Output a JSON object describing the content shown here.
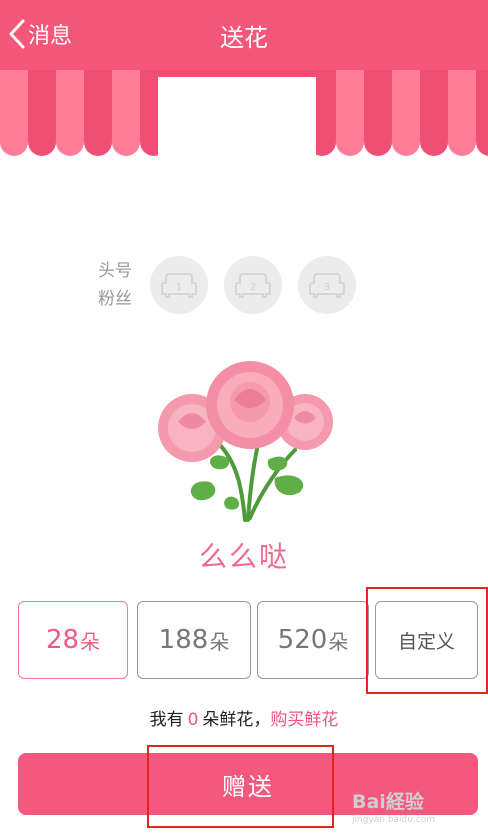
{
  "header": {
    "back_label": "消息",
    "title": "送花"
  },
  "fans": {
    "label_line1": "头号",
    "label_line2": "粉丝",
    "ranks": [
      "1",
      "2",
      "3"
    ]
  },
  "gift": {
    "name": "么么哒"
  },
  "options": [
    {
      "num": "28",
      "unit": "朵",
      "selected": true
    },
    {
      "num": "188",
      "unit": "朵",
      "selected": false
    },
    {
      "num": "520",
      "unit": "朵",
      "selected": false
    },
    {
      "custom": "自定义"
    }
  ],
  "balance": {
    "prefix": "我有",
    "count": "0",
    "suffix": "朵鲜花，",
    "buy_link": "购买鲜花"
  },
  "send_button": {
    "label": "赠送"
  },
  "watermark": {
    "brand": "Bai経验",
    "url": "jingyan.baidu.com"
  },
  "colors": {
    "primary": "#f5577b",
    "awning_dark": "#f04f75",
    "awning_light": "#ff7d98",
    "annotation_red": "#e0261f"
  },
  "icons": {
    "back": "chevron-left-icon",
    "seat": "sofa-seat-icon",
    "gift": "rose-bouquet-icon"
  }
}
